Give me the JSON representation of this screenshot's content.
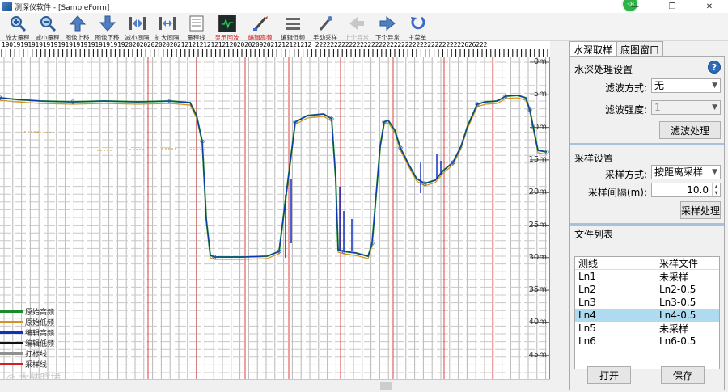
{
  "window": {
    "title": "测深仪软件 - [SampleForm]",
    "notify_count": "38",
    "controls": {
      "minimize": "—",
      "restore": "❐",
      "close": "✕"
    }
  },
  "toolbar": [
    {
      "label": "放大量程",
      "icon": "zoom-in-icon",
      "red": false,
      "disabled": false
    },
    {
      "label": "减小量程",
      "icon": "zoom-out-icon",
      "red": false,
      "disabled": false
    },
    {
      "label": "图像上移",
      "icon": "arrow-up-icon",
      "red": false,
      "disabled": false
    },
    {
      "label": "图像下移",
      "icon": "arrow-down-icon",
      "red": false,
      "disabled": false
    },
    {
      "label": "减小间隔",
      "icon": "compress-horizontal-icon",
      "red": false,
      "disabled": false
    },
    {
      "label": "扩大间隔",
      "icon": "expand-horizontal-icon",
      "red": false,
      "disabled": false
    },
    {
      "label": "量程线",
      "icon": "range-line-icon",
      "red": false,
      "disabled": false
    },
    {
      "label": "显示回波",
      "icon": "echo-display-icon",
      "red": true,
      "disabled": false,
      "active": true
    },
    {
      "label": "编辑高频",
      "icon": "edit-high-freq-icon",
      "red": true,
      "disabled": false
    },
    {
      "label": "编辑低频",
      "icon": "edit-low-freq-icon",
      "red": false,
      "disabled": false
    },
    {
      "label": "手动采样",
      "icon": "manual-sample-icon",
      "red": false,
      "disabled": false
    },
    {
      "label": "上个异常",
      "icon": "prev-anomaly-icon",
      "red": false,
      "disabled": true
    },
    {
      "label": "下个异常",
      "icon": "next-anomaly-icon",
      "red": false,
      "disabled": false
    },
    {
      "label": "主菜单",
      "icon": "main-menu-icon",
      "red": false,
      "disabled": false
    }
  ],
  "ruler": {
    "text": "19019191919191919191919191919191920202020202020212121212121212020202092021212121212 2222222222222222222222222222222222222222626222"
  },
  "depth_axis": [
    "0m",
    "5m",
    "10m",
    "15m",
    "20m",
    "25m",
    "30m",
    "35m",
    "40m",
    "45m"
  ],
  "legend": [
    {
      "label": "原始高频",
      "color": "#1a8a2a"
    },
    {
      "label": "原始低频",
      "color": "#d89020"
    },
    {
      "label": "编辑高频",
      "color": "#1030c0"
    },
    {
      "label": "编辑低频",
      "color": "#111111"
    },
    {
      "label": "打标线",
      "color": "#909090"
    },
    {
      "label": "采样线",
      "color": "#d02020"
    }
  ],
  "watermark": "◎ 大驶晗境",
  "panel": {
    "tabs": [
      "水深取样",
      "底图窗口"
    ],
    "depth_section": {
      "title": "水深处理设置",
      "help": "?",
      "filter_mode_label": "滤波方式:",
      "filter_mode_value": "无",
      "filter_strength_label": "滤波强度:",
      "filter_strength_value": "1",
      "filter_button": "滤波处理"
    },
    "sample_section": {
      "title": "采样设置",
      "mode_label": "采样方式:",
      "mode_value": "按距离采样",
      "interval_label": "采样间隔(m):",
      "interval_value": "10.0",
      "sample_button": "采样处理"
    },
    "file_section": {
      "title": "文件列表",
      "columns": [
        "测线",
        "采样文件"
      ],
      "rows": [
        {
          "line": "Ln1",
          "file": "未采样",
          "selected": false
        },
        {
          "line": "Ln2",
          "file": "Ln2-0.5",
          "selected": false
        },
        {
          "line": "Ln3",
          "file": "Ln3-0.5",
          "selected": false
        },
        {
          "line": "Ln4",
          "file": "Ln4-0.5",
          "selected": true
        },
        {
          "line": "Ln5",
          "file": "未采样",
          "selected": false
        },
        {
          "line": "Ln6",
          "file": "Ln6-0.5",
          "selected": false
        }
      ],
      "open_button": "打开",
      "save_button": "保存"
    }
  }
}
